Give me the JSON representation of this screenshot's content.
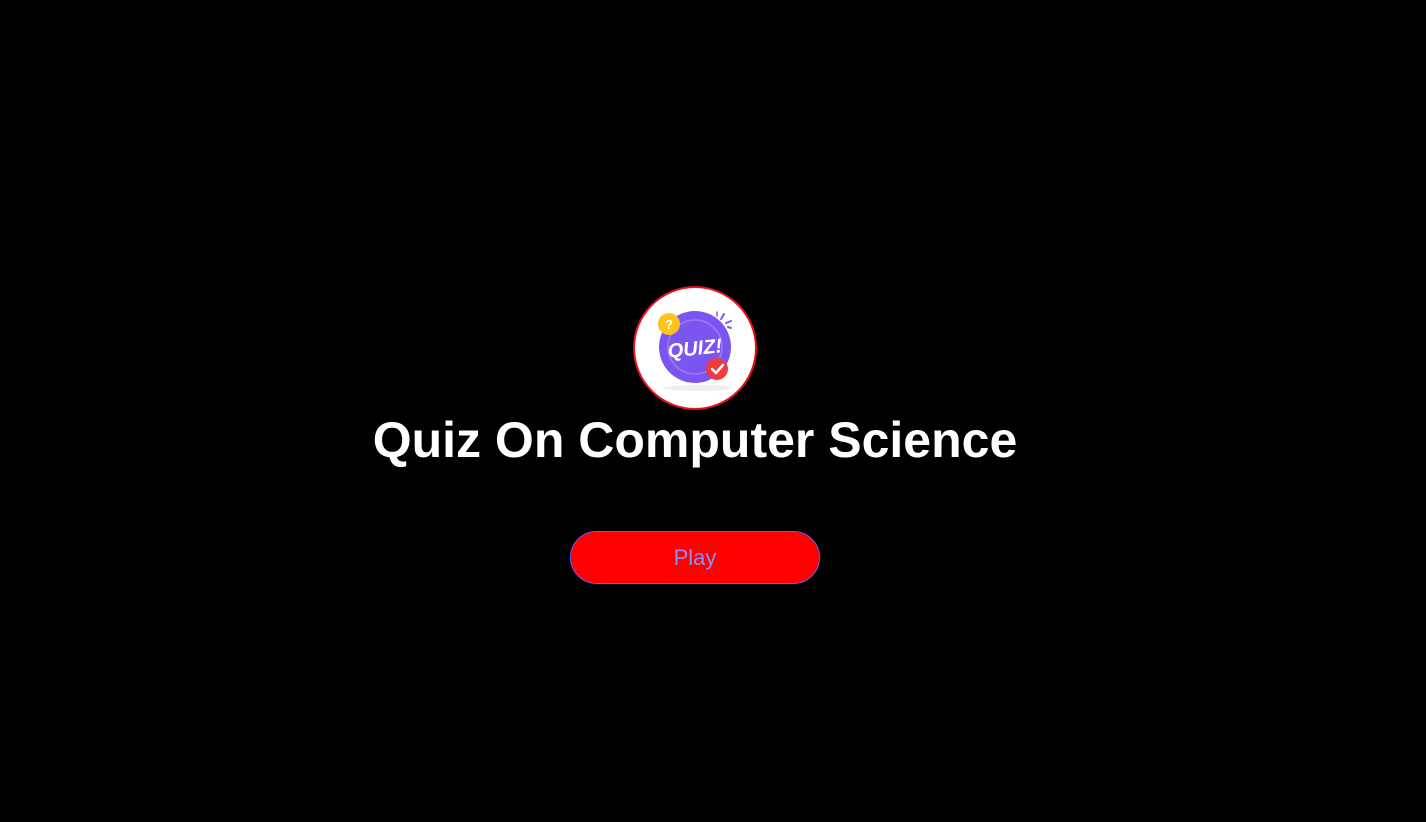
{
  "quiz": {
    "logo_text": "QUIZ!",
    "logo_badge_question": "?",
    "title": "Quiz On Computer Science",
    "play_label": "Play"
  },
  "colors": {
    "background": "#000000",
    "button_fill": "#ff0000",
    "button_text": "#8f8cf3",
    "logo_purple": "#7b55f0",
    "logo_border": "#e8101a"
  }
}
